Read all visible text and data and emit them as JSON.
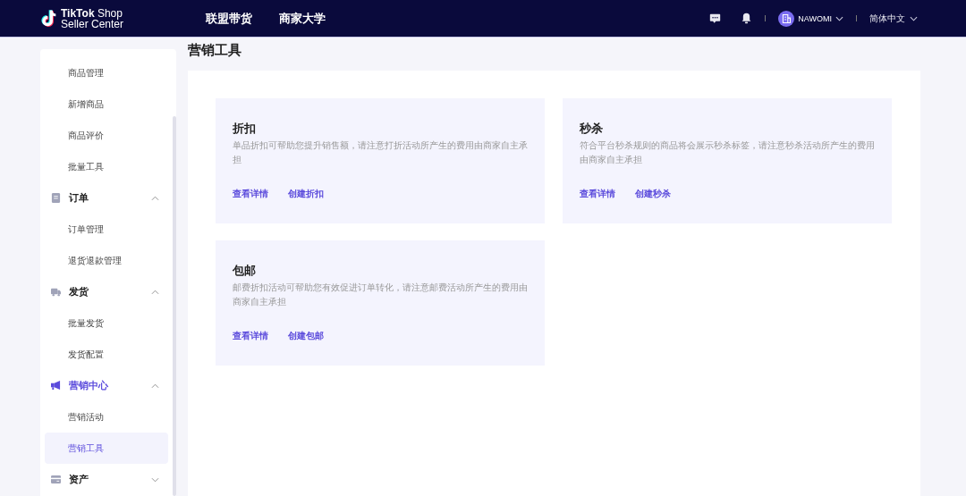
{
  "header": {
    "logo_line_1": "**TikTok** Shop",
    "logo_line_2": "Seller Center",
    "nav": [
      {
        "label": "联盟带货"
      },
      {
        "label": "商家大学"
      }
    ],
    "user": {
      "name": "NAWOMI"
    },
    "language": "简体中文"
  },
  "sidebar": {
    "groups": [
      {
        "children": [
          {
            "label": "商品管理",
            "selected": false
          },
          {
            "label": "新增商品",
            "selected": false
          },
          {
            "label": "商品评价",
            "selected": false
          },
          {
            "label": "批量工具",
            "selected": false
          }
        ]
      },
      {
        "label": "订单",
        "expanded": true,
        "active": false,
        "children": [
          {
            "label": "订单管理",
            "selected": false
          },
          {
            "label": "退货退款管理",
            "selected": false
          }
        ]
      },
      {
        "label": "发货",
        "expanded": true,
        "active": false,
        "children": [
          {
            "label": "批量发货",
            "selected": false
          },
          {
            "label": "发货配置",
            "selected": false
          }
        ]
      },
      {
        "label": "营销中心",
        "expanded": true,
        "active": true,
        "children": [
          {
            "label": "营销活动",
            "selected": false
          },
          {
            "label": "营销工具",
            "selected": true
          }
        ]
      },
      {
        "label": "资产",
        "expanded": false,
        "active": false
      }
    ]
  },
  "page_title": "营销工具",
  "cards": [
    {
      "title": "折扣",
      "description": "单品折扣可帮助您提升销售额，请注意打折活动所产生的费用由商家自主承担",
      "links": [
        "查看详情",
        "创建折扣"
      ]
    },
    {
      "title": "秒杀",
      "description": "符合平台秒杀规则的商品将会展示秒杀标签，请注意秒杀活动所产生的费用由商家自主承担",
      "links": [
        "查看详情",
        "创建秒杀"
      ]
    },
    {
      "title": "包邮",
      "description": "邮费折扣活动可帮助您有效促进订单转化，请注意邮费活动所产生的费用由商家自主承担",
      "links": [
        "查看详情",
        "创建包邮"
      ]
    }
  ]
}
